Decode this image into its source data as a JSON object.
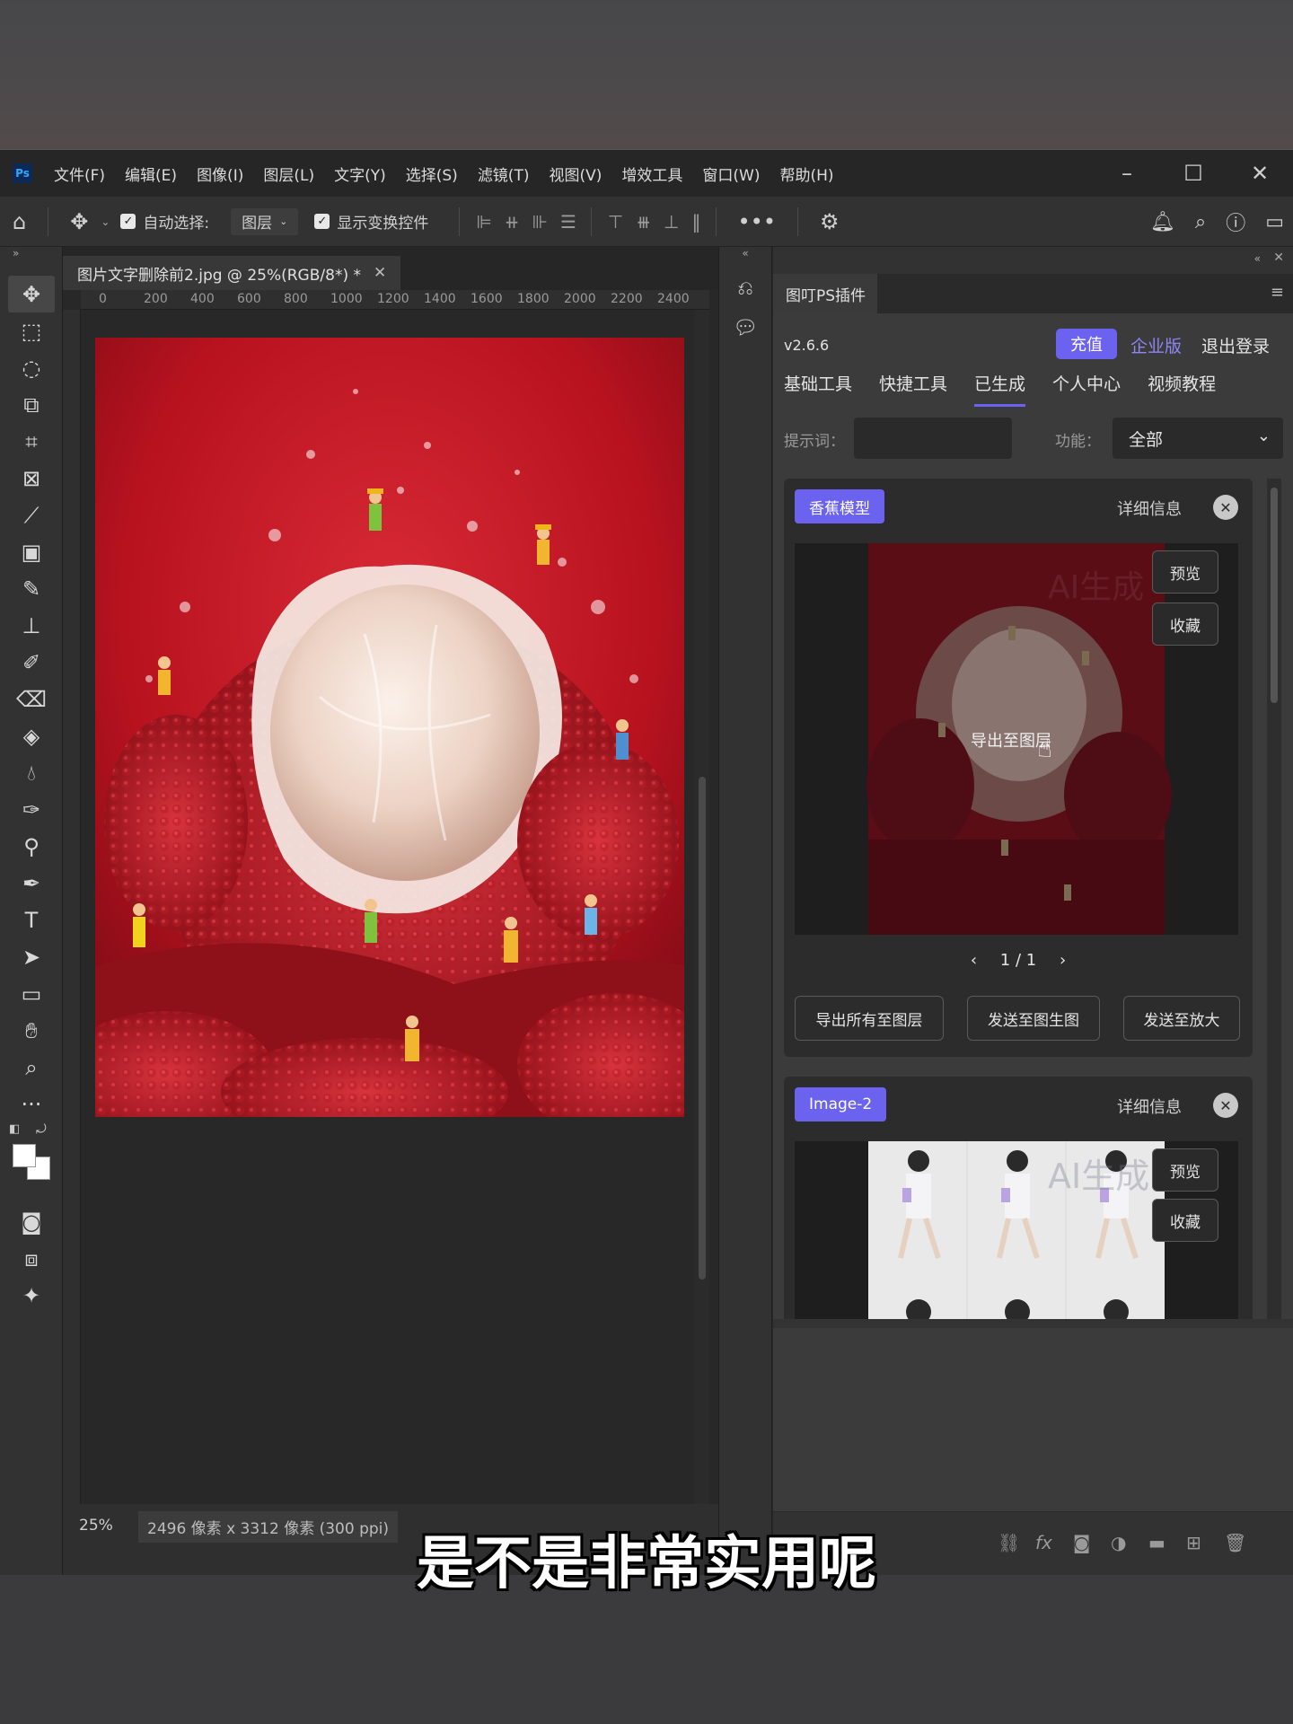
{
  "app": {
    "logo": "Ps"
  },
  "menu": [
    "文件(F)",
    "编辑(E)",
    "图像(I)",
    "图层(L)",
    "文字(Y)",
    "选择(S)",
    "滤镜(T)",
    "视图(V)",
    "增效工具",
    "窗口(W)",
    "帮助(H)"
  ],
  "options": {
    "auto_select_label": "自动选择:",
    "auto_select_value": "图层",
    "show_transform_label": "显示变换控件"
  },
  "document": {
    "tab_title": "图片文字删除前2.jpg @ 25%(RGB/8*) *",
    "ruler_ticks": [
      "0",
      "200",
      "400",
      "600",
      "800",
      "1000",
      "1200",
      "1400",
      "1600",
      "1800",
      "2000",
      "2200",
      "2400"
    ],
    "zoom": "25%",
    "dimensions": "2496 像素 x 3312 像素 (300 ppi)"
  },
  "plugin": {
    "panel_title": "图叮PS插件",
    "version": "v2.6.6",
    "recharge": "充值",
    "enterprise": "企业版",
    "logout": "退出登录",
    "nav": [
      "基础工具",
      "快捷工具",
      "已生成",
      "个人中心",
      "视频教程"
    ],
    "active_nav": "已生成",
    "prompt_label": "提示词：",
    "prompt_value": "",
    "function_label": "功能：",
    "function_value": "全部",
    "cards": [
      {
        "tag": "香蕉模型",
        "detail": "详细信息",
        "preview_button": "预览",
        "favorite_button": "收藏",
        "hover_text": "导出至图层",
        "watermark": "AI生成",
        "pager": "1 / 1",
        "actions": [
          "导出所有至图层",
          "发送至图生图",
          "发送至放大"
        ]
      },
      {
        "tag": "Image-2",
        "detail": "详细信息",
        "preview_button": "预览",
        "favorite_button": "收藏",
        "watermark": "AI生成"
      }
    ]
  },
  "subtitle": "是不是非常实用呢",
  "colors": {
    "accent": "#6b62f0",
    "lychee_red": "#c4162a",
    "bg": "#323232"
  }
}
